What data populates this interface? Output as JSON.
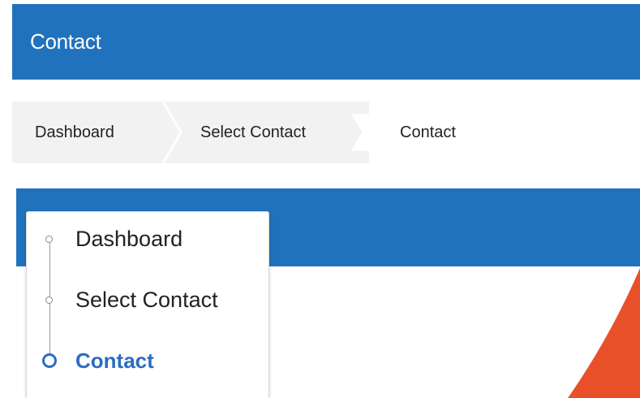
{
  "header": {
    "title": "Contact"
  },
  "breadcrumb": {
    "items": [
      {
        "label": "Dashboard"
      },
      {
        "label": "Select Contact"
      },
      {
        "label": "Contact"
      }
    ]
  },
  "step_menu": {
    "steps": [
      {
        "label": "Dashboard",
        "active": false
      },
      {
        "label": "Select Contact",
        "active": false
      },
      {
        "label": "Contact",
        "active": true
      }
    ]
  },
  "colors": {
    "header_blue": "#2072bd",
    "breadcrumb_bg": "#f2f2f2",
    "active_step_blue": "#2d6cc0",
    "accent_orange": "#e8502a"
  }
}
